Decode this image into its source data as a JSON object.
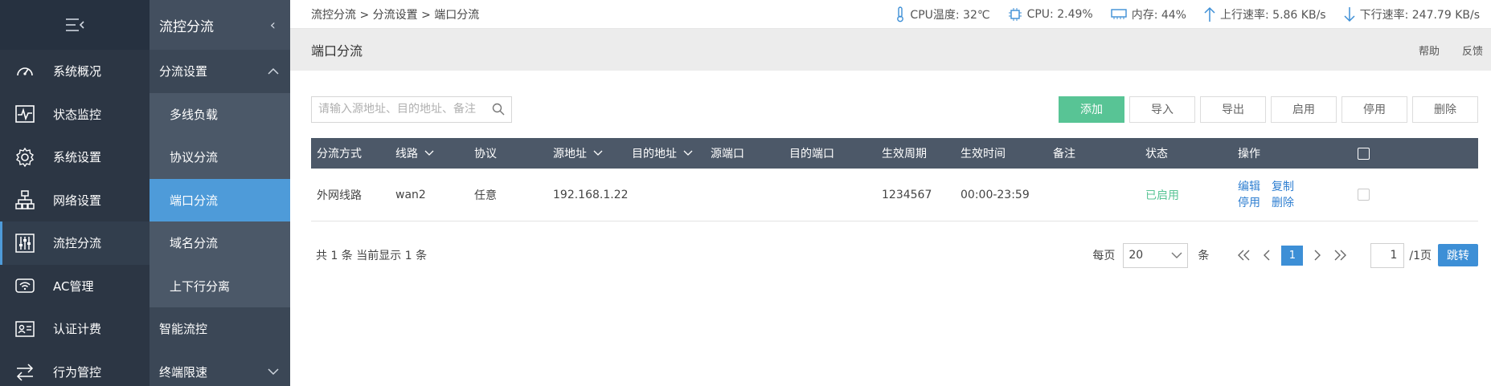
{
  "nav1": {
    "items": [
      {
        "label": "系统概况",
        "icon": "dashboard-icon"
      },
      {
        "label": "状态监控",
        "icon": "monitor-icon"
      },
      {
        "label": "系统设置",
        "icon": "gear-icon"
      },
      {
        "label": "网络设置",
        "icon": "network-icon"
      },
      {
        "label": "流控分流",
        "icon": "sliders-icon"
      },
      {
        "label": "AC管理",
        "icon": "wifi-icon"
      },
      {
        "label": "认证计费",
        "icon": "id-card-icon"
      },
      {
        "label": "行为管控",
        "icon": "swap-icon"
      }
    ]
  },
  "nav2": {
    "title": "流控分流",
    "items": [
      {
        "label": "分流设置"
      },
      {
        "label": "多线负载"
      },
      {
        "label": "协议分流"
      },
      {
        "label": "端口分流"
      },
      {
        "label": "域名分流"
      },
      {
        "label": "上下行分离"
      },
      {
        "label": "智能流控"
      },
      {
        "label": "终端限速"
      }
    ]
  },
  "topbar": {
    "breadcrumb": "流控分流 > 分流设置 > 端口分流",
    "cpu_temp": "CPU温度: 32℃",
    "cpu": "CPU: 2.49%",
    "memory": "内存: 44%",
    "upload": "上行速率: 5.86 KB/s",
    "download": "下行速率: 247.79 KB/s"
  },
  "page": {
    "title": "端口分流",
    "help": "帮助",
    "feedback": "反馈"
  },
  "toolbar": {
    "search_placeholder": "请输入源地址、目的地址、备注",
    "add": "添加",
    "import": "导入",
    "export": "导出",
    "enable": "启用",
    "disable": "停用",
    "delete": "删除"
  },
  "table": {
    "columns": [
      "分流方式",
      "线路",
      "协议",
      "源地址",
      "目的地址",
      "源端口",
      "目的端口",
      "生效周期",
      "生效时间",
      "备注",
      "状态",
      "操作"
    ],
    "rows": [
      {
        "mode": "外网线路",
        "line": "wan2",
        "protocol": "任意",
        "src_addr": "192.168.1.22",
        "dst_addr": "",
        "src_port": "",
        "dst_port": "",
        "period": "1234567",
        "time": "00:00-23:59",
        "remark": "",
        "status": "已启用",
        "ops": {
          "edit": "编辑",
          "copy": "复制",
          "disable": "停用",
          "delete": "删除"
        }
      }
    ]
  },
  "footer": {
    "total": "共 1 条 当前显示 1 条",
    "per_page_label": "每页",
    "per_page_value": "20",
    "per_page_unit": "条",
    "current_page": "1",
    "page_input": "1",
    "total_pages": "/1页",
    "jump": "跳转"
  }
}
